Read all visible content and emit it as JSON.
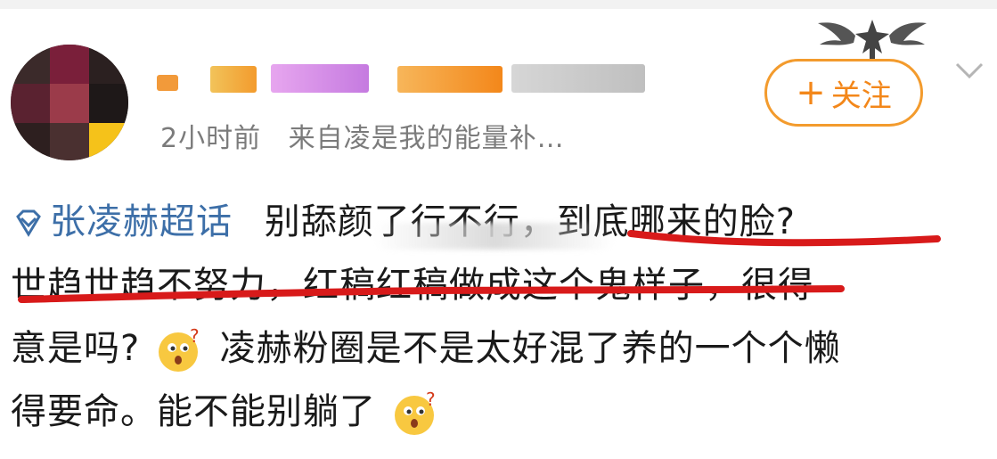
{
  "header": {
    "time_ago": "2小时前",
    "source_prefix": "来自",
    "source_name": "凌是我的能量补…",
    "follow_label": "关注",
    "follow_plus": "+"
  },
  "post": {
    "topic": "张凌赫超话",
    "line1_text": "别舔颜了行不行，",
    "line1_highlight": "到底哪来的脸?",
    "line2_text": "世趋世趋不努力，红稿红稿做成这个鬼样子，很得",
    "line3_a": "意是吗?",
    "line3_b": "凌赫粉圈是不是太好混了养的一个个懒",
    "line4": "得要命。能不能别躺了"
  },
  "colors": {
    "accent_orange": "#f3871a",
    "topic_blue": "#3d6fa8",
    "underline_red": "#d81a1a",
    "meta_grey": "#7b7b7b"
  },
  "icons": {
    "topic": "supertopic-diamond-icon",
    "emoji": "thinking-face-emoji-icon",
    "more": "chevron-down-icon"
  }
}
